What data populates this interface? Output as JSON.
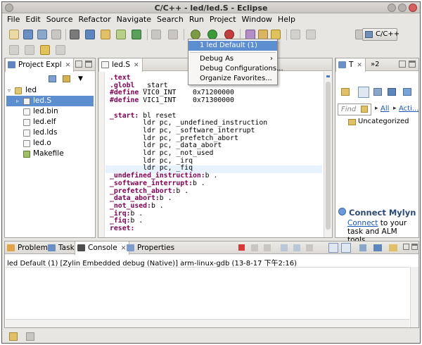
{
  "window": {
    "title": "C/C++ - led/led.S - Eclipse"
  },
  "menubar": [
    "File",
    "Edit",
    "Source",
    "Refactor",
    "Navigate",
    "Search",
    "Run",
    "Project",
    "Window",
    "Help"
  ],
  "perspective": {
    "label": "C/C++"
  },
  "debug_menu": {
    "items": [
      {
        "label": "1 led Default (1)",
        "highlighted": true
      },
      {
        "label": "Debug As",
        "submenu": true
      },
      {
        "label": "Debug Configurations..."
      },
      {
        "label": "Organize Favorites..."
      }
    ]
  },
  "project_explorer": {
    "tab_label": "Project Expl",
    "tree": [
      {
        "label": "led",
        "icon": "project-folder-icon",
        "indent": 0,
        "selected": false
      },
      {
        "label": "led.S",
        "icon": "asm-file-icon",
        "indent": 1,
        "selected": true
      },
      {
        "label": "led.bin",
        "icon": "file-icon",
        "indent": 1,
        "selected": false
      },
      {
        "label": "led.elf",
        "icon": "file-icon",
        "indent": 1,
        "selected": false
      },
      {
        "label": "led.lds",
        "icon": "file-icon",
        "indent": 1,
        "selected": false
      },
      {
        "label": "led.o",
        "icon": "file-icon",
        "indent": 1,
        "selected": false
      },
      {
        "label": "Makefile",
        "icon": "makefile-icon",
        "indent": 1,
        "selected": false
      }
    ]
  },
  "editor": {
    "tab_label": "led.S",
    "code": [
      ".text",
      ".globl  _start",
      "#define VIC0_INT    0x71200000",
      "#define VIC1_INT    0x71300000",
      "",
      "_start: bl reset",
      "        ldr pc, _undefined_instruction",
      "        ldr pc, _software_interrupt",
      "        ldr pc, _prefetch_abort",
      "        ldr pc, _data_abort",
      "        ldr pc, _not_used",
      "        ldr pc, _irq",
      "        ldr pc, _fiq",
      "_undefined_instruction:b .",
      "_software_interrupt:b .",
      "_prefetch_abort:b .",
      "_data_abort:b .",
      "_not_used:b .",
      "_irq:b .",
      "_fiq:b .",
      "reset:"
    ]
  },
  "task_list": {
    "tab_label": "T",
    "tab2_label": "»2",
    "find_placeholder": "Find",
    "all_label": "All",
    "acti_label": "Acti...",
    "category": "Uncategorized"
  },
  "mylyn": {
    "title": "Connect Mylyn",
    "link_text": "Connect",
    "text_rest": " to your task and ALM tools."
  },
  "bottom_tabs": {
    "problems": "Problems",
    "tasks": "Tasks",
    "console": "Console",
    "properties": "Properties"
  },
  "console": {
    "line": "led Default (1) [Zylin Embedded debug (Native)] arm-linux-gdb (13-8-17 下午2:16)"
  },
  "colors": {
    "selection": "#5c8ed0",
    "keyword": "#7f0055",
    "link": "#1c57b5"
  }
}
